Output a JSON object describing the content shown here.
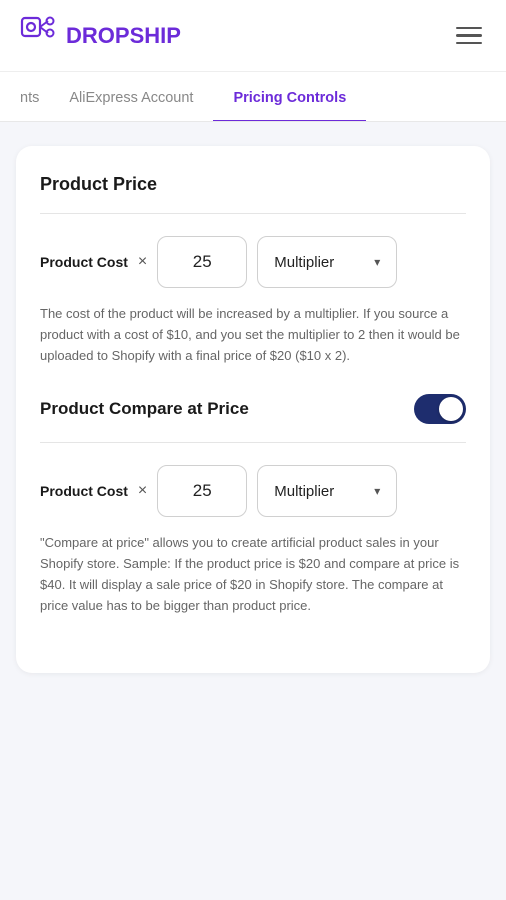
{
  "header": {
    "logo_text_d": "D",
    "logo_text_rest": "ROPSHIP"
  },
  "tabs": {
    "partial_label": "nts",
    "aliexpress_label": "AliExpress Account",
    "pricing_label": "Pricing Controls"
  },
  "product_price_section": {
    "title": "Product Price",
    "input_value_1": "25",
    "dropdown_label_1": "Multiplier",
    "description": "The cost of the product will be increased by a multiplier. If you source a product with a cost of $10, and you set the multiplier to 2 then it would be uploaded to Shopify with a final price of $20 ($10 x 2).",
    "row_label": "Product Cost",
    "multiply_sign": "×"
  },
  "compare_section": {
    "title": "Product Compare at Price",
    "toggle_on": true,
    "row_label": "Product Cost",
    "multiply_sign": "×",
    "input_value": "25",
    "dropdown_label": "Multiplier",
    "description": "\"Compare at price\" allows you to create artificial product sales in your Shopify store. Sample: If the product price is $20 and compare at price is $40. It will display a sale price of $20 in Shopify store. The compare at price value has to be bigger than product price."
  },
  "icons": {
    "chevron": "▾",
    "multiply": "×"
  }
}
